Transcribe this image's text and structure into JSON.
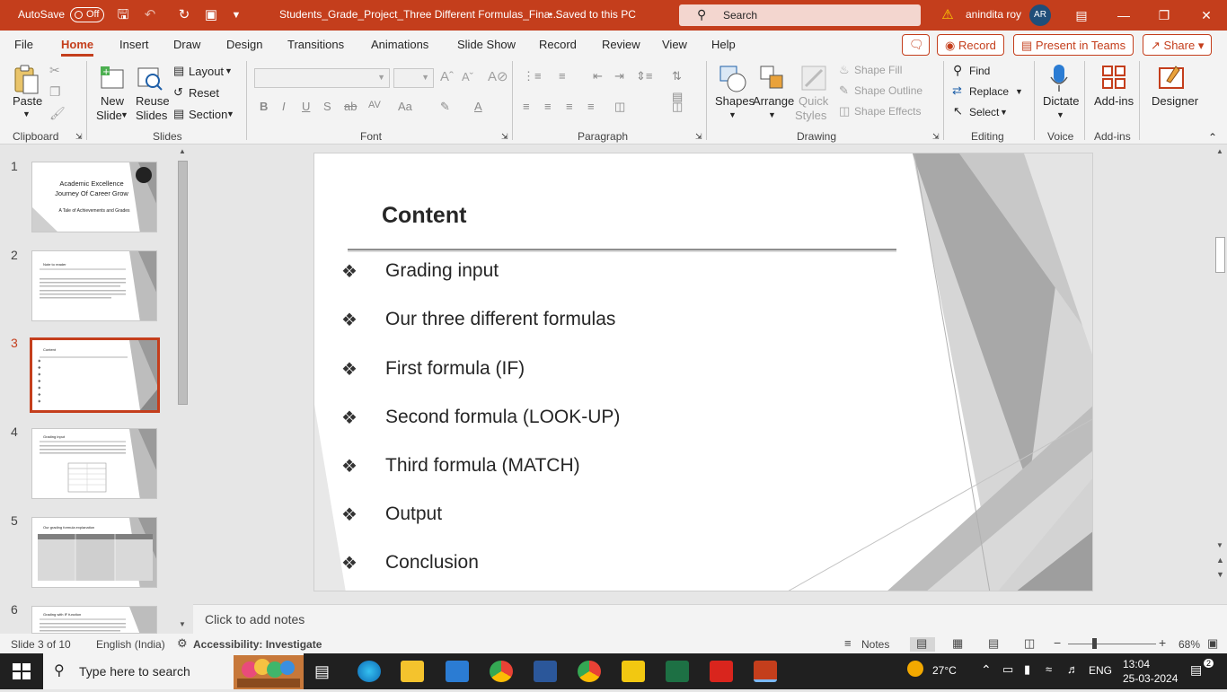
{
  "titlebar": {
    "autosave": "AutoSave",
    "toggle": "Off",
    "filename": "Students_Grade_Project_Three Different Formulas_Fina...",
    "saved": "•  Saved to this PC",
    "search_placeholder": "Search",
    "user": "anindita roy",
    "initials": "AR"
  },
  "menu": {
    "tabs": [
      "File",
      "Home",
      "Insert",
      "Draw",
      "Design",
      "Transitions",
      "Animations",
      "Slide Show",
      "Record",
      "Review",
      "View",
      "Help"
    ],
    "active": "Home",
    "record_btn": "Record",
    "present_btn": "Present in Teams",
    "share_btn": "Share"
  },
  "ribbon": {
    "clipboard": {
      "label": "Clipboard",
      "paste": "Paste"
    },
    "slides": {
      "label": "Slides",
      "new_slide_1": "New",
      "new_slide_2": "Slide",
      "reuse_1": "Reuse",
      "reuse_2": "Slides",
      "layout": "Layout",
      "reset": "Reset",
      "section": "Section"
    },
    "font": {
      "label": "Font"
    },
    "paragraph": {
      "label": "Paragraph"
    },
    "drawing": {
      "label": "Drawing",
      "shapes": "Shapes",
      "arrange": "Arrange",
      "quick_1": "Quick",
      "quick_2": "Styles",
      "fill": "Shape Fill",
      "outline": "Shape Outline",
      "effects": "Shape Effects"
    },
    "editing": {
      "label": "Editing",
      "find": "Find",
      "replace": "Replace",
      "select": "Select"
    },
    "voice": {
      "label": "Voice",
      "dictate": "Dictate"
    },
    "addins": {
      "label": "Add-ins",
      "addins": "Add-ins"
    },
    "designer": {
      "designer": "Designer"
    }
  },
  "thumbs": [
    {
      "n": "1",
      "title": "Academic Excellence Journey Of Career Grow",
      "sub": "A Tale of Achievements and Grades"
    },
    {
      "n": "2",
      "title": "Note to reader"
    },
    {
      "n": "3",
      "title": "Content"
    },
    {
      "n": "4",
      "title": "Grading input"
    },
    {
      "n": "5",
      "title": "Our grading formula explanation"
    },
    {
      "n": "6",
      "title": "Grading with IF function"
    }
  ],
  "slide": {
    "title": "Content",
    "bullets": [
      "Grading input",
      "Our three different formulas",
      "First formula (IF)",
      "Second formula (LOOK-UP)",
      "Third formula (MATCH)",
      "Output",
      "Conclusion"
    ]
  },
  "notes_placeholder": "Click to add notes",
  "status": {
    "slide": "Slide 3 of 10",
    "lang": "English (India)",
    "accessibility": "Accessibility: Investigate",
    "notes": "Notes",
    "zoom": "68%"
  },
  "taskbar": {
    "search": "Type here to search",
    "weather": "27°C",
    "lang": "ENG",
    "time": "13:04",
    "date": "25-03-2024",
    "badge": "2"
  },
  "colors": {
    "accent": "#c43e1c"
  }
}
